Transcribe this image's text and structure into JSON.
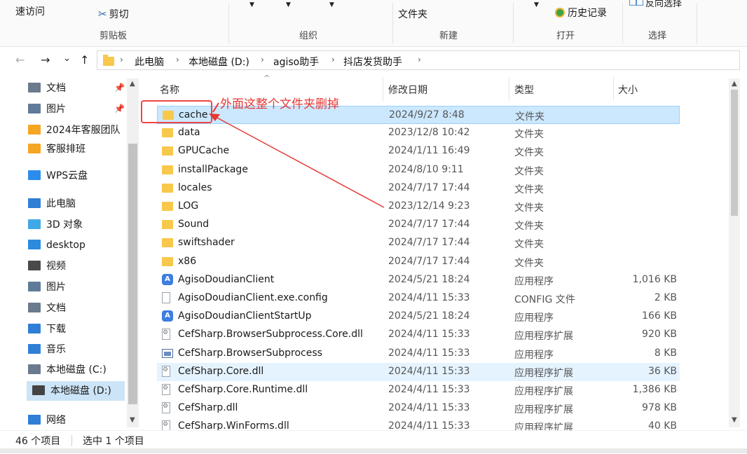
{
  "ribbon": {
    "quick_access": "速访问",
    "cut": "剪切",
    "file_folder": "文件夹",
    "history": "历史记录",
    "reverse_select": "反向选择",
    "groups": [
      "剪贴板",
      "组织",
      "新建",
      "打开",
      "选择"
    ]
  },
  "nav": {
    "back_icon": "←",
    "forward_icon": "→",
    "recent_icon": "⌄",
    "up_icon": "↑",
    "breadcrumb": [
      "此电脑",
      "本地磁盘 (D:)",
      "agiso助手",
      "抖店发货助手"
    ]
  },
  "sidebar": {
    "items": [
      {
        "label": "文档",
        "icon": "document-icon",
        "color": "#6b7a8c"
      },
      {
        "label": "图片",
        "icon": "pictures-icon",
        "color": "#5f7b99"
      },
      {
        "label": "2024年客服团队",
        "icon": "wps-folder-icon",
        "color": "#f5a623"
      },
      {
        "label": "客服排班",
        "icon": "wps-folder-icon",
        "color": "#f5a623"
      },
      {
        "label": "WPS云盘",
        "icon": "cloud-icon",
        "color": "#2d8ceb"
      },
      {
        "label": "此电脑",
        "icon": "computer-icon",
        "color": "#2f7fd6"
      },
      {
        "label": "3D 对象",
        "icon": "3d-objects-icon",
        "color": "#3fa9e8"
      },
      {
        "label": "desktop",
        "icon": "desktop-icon",
        "color": "#2c8adf"
      },
      {
        "label": "视频",
        "icon": "video-icon",
        "color": "#4a4a4a"
      },
      {
        "label": "图片",
        "icon": "pictures-icon",
        "color": "#5f7b99"
      },
      {
        "label": "文档",
        "icon": "document-icon",
        "color": "#6b7a8c"
      },
      {
        "label": "下载",
        "icon": "download-icon",
        "color": "#2f7fd6"
      },
      {
        "label": "音乐",
        "icon": "music-icon",
        "color": "#2f7fd6"
      },
      {
        "label": "本地磁盘 (C:)",
        "icon": "drive-c-icon",
        "color": "#6b7a8c"
      },
      {
        "label": "本地磁盘 (D:)",
        "icon": "drive-d-icon",
        "color": "#444444"
      },
      {
        "label": "网络",
        "icon": "network-icon",
        "color": "#2f7fd6"
      }
    ]
  },
  "columns": {
    "name": "名称",
    "date": "修改日期",
    "type": "类型",
    "size": "大小"
  },
  "files": [
    {
      "name": "cache",
      "date": "2024/9/27 8:48",
      "type": "文件夹",
      "size": "",
      "icon": "folder"
    },
    {
      "name": "data",
      "date": "2023/12/8 10:42",
      "type": "文件夹",
      "size": "",
      "icon": "folder"
    },
    {
      "name": "GPUCache",
      "date": "2024/1/11 16:49",
      "type": "文件夹",
      "size": "",
      "icon": "folder"
    },
    {
      "name": "installPackage",
      "date": "2024/8/10 9:11",
      "type": "文件夹",
      "size": "",
      "icon": "folder"
    },
    {
      "name": "locales",
      "date": "2024/7/17 17:44",
      "type": "文件夹",
      "size": "",
      "icon": "folder"
    },
    {
      "name": "LOG",
      "date": "2023/12/14 9:23",
      "type": "文件夹",
      "size": "",
      "icon": "folder"
    },
    {
      "name": "Sound",
      "date": "2024/7/17 17:44",
      "type": "文件夹",
      "size": "",
      "icon": "folder"
    },
    {
      "name": "swiftshader",
      "date": "2024/7/17 17:44",
      "type": "文件夹",
      "size": "",
      "icon": "folder"
    },
    {
      "name": "x86",
      "date": "2024/7/17 17:44",
      "type": "文件夹",
      "size": "",
      "icon": "folder"
    },
    {
      "name": "AgisoDoudianClient",
      "date": "2024/5/21 18:24",
      "type": "应用程序",
      "size": "1,016 KB",
      "icon": "app"
    },
    {
      "name": "AgisoDoudianClient.exe.config",
      "date": "2024/4/11 15:33",
      "type": "CONFIG 文件",
      "size": "2 KB",
      "icon": "doc"
    },
    {
      "name": "AgisoDoudianClientStartUp",
      "date": "2024/5/21 18:24",
      "type": "应用程序",
      "size": "166 KB",
      "icon": "app"
    },
    {
      "name": "CefSharp.BrowserSubprocess.Core.dll",
      "date": "2024/4/11 15:33",
      "type": "应用程序扩展",
      "size": "920 KB",
      "icon": "dll"
    },
    {
      "name": "CefSharp.BrowserSubprocess",
      "date": "2024/4/11 15:33",
      "type": "应用程序",
      "size": "8 KB",
      "icon": "win"
    },
    {
      "name": "CefSharp.Core.dll",
      "date": "2024/4/11 15:33",
      "type": "应用程序扩展",
      "size": "36 KB",
      "icon": "dll"
    },
    {
      "name": "CefSharp.Core.Runtime.dll",
      "date": "2024/4/11 15:33",
      "type": "应用程序扩展",
      "size": "1,386 KB",
      "icon": "dll"
    },
    {
      "name": "CefSharp.dll",
      "date": "2024/4/11 15:33",
      "type": "应用程序扩展",
      "size": "978 KB",
      "icon": "dll"
    },
    {
      "name": "CefSharp.WinForms.dll",
      "date": "2024/4/11 15:33",
      "type": "应用程序扩展",
      "size": "40 KB",
      "icon": "dll"
    }
  ],
  "annotation": {
    "text": "外面这整个文件夹删掉",
    "color": "#e53935"
  },
  "status": {
    "item_count": "46 个项目",
    "selected": "选中 1 个项目"
  }
}
